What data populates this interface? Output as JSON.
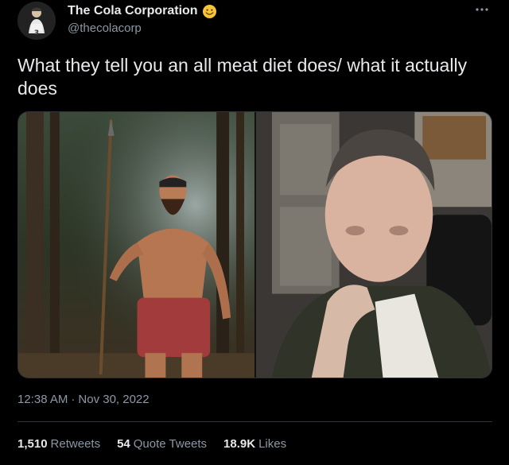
{
  "author": {
    "display_name": "The Cola Corporation",
    "handle": "@thecolacorp",
    "emoji": "smiling-face-emoji"
  },
  "tweet": {
    "text": "What they tell you an all meat diet does/ what it actually does",
    "time": "12:38 AM",
    "separator": "·",
    "date": "Nov 30, 2022"
  },
  "stats": {
    "retweets_count": "1,510",
    "retweets_label": "Retweets",
    "quotes_count": "54",
    "quotes_label": "Quote Tweets",
    "likes_count": "18.9K",
    "likes_label": "Likes"
  },
  "icons": {
    "more": "more-dots-icon"
  },
  "colors": {
    "background": "#000000",
    "primary_text": "#e7e9ea",
    "secondary_text": "#8b98a5",
    "divider": "#2f3336"
  }
}
